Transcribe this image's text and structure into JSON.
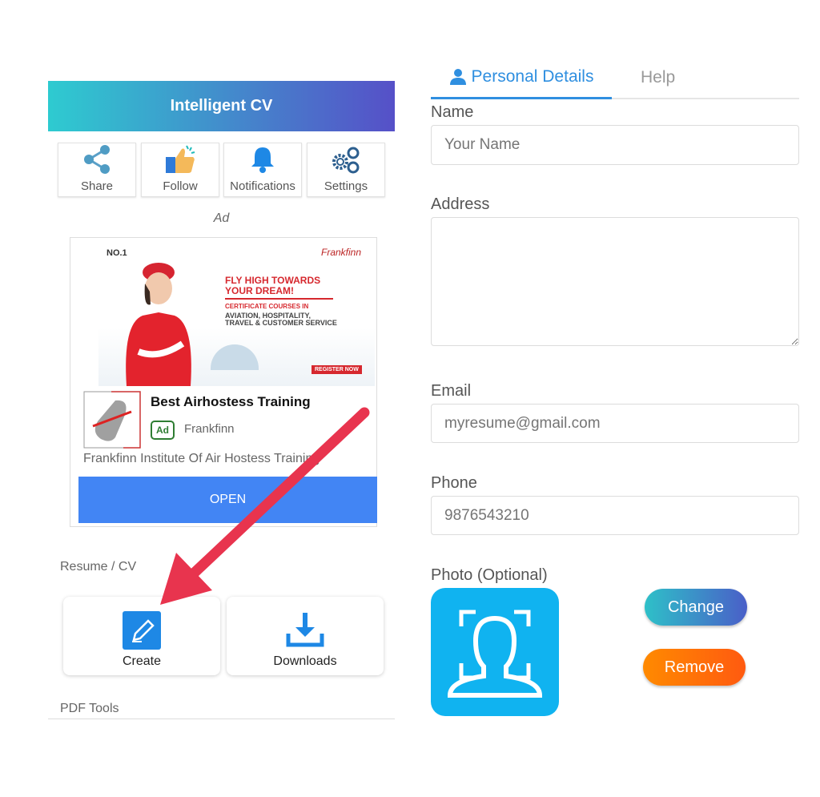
{
  "left": {
    "app_title": "Intelligent CV",
    "tiles": [
      {
        "label": "Share",
        "icon": "share-icon"
      },
      {
        "label": "Follow",
        "icon": "thumbs-up-icon"
      },
      {
        "label": "Notifications",
        "icon": "bell-icon"
      },
      {
        "label": "Settings",
        "icon": "gear-icon"
      }
    ],
    "ad_label": "Ad",
    "ad": {
      "banner": {
        "badge": "NO.1",
        "brand": "Frankfinn",
        "headline1": "FLY HIGH TOWARDS",
        "headline2": "YOUR DREAM!",
        "sub1": "CERTIFICATE COURSES IN",
        "sub2": "AVIATION, HOSPITALITY,",
        "sub3": "TRAVEL & CUSTOMER SERVICE",
        "cta": "REGISTER NOW"
      },
      "title": "Best Airhostess Training",
      "badge": "Ad",
      "advertiser": "Frankfinn",
      "description": "Frankfinn Institute Of Air Hostess Training",
      "open_label": "OPEN"
    },
    "resume_section": "Resume / CV",
    "cards": [
      {
        "label": "Create",
        "icon": "edit-icon"
      },
      {
        "label": "Downloads",
        "icon": "download-icon"
      }
    ],
    "pdf_section": "PDF Tools"
  },
  "right": {
    "tabs": [
      {
        "label": "Personal Details",
        "active": true
      },
      {
        "label": "Help",
        "active": false
      }
    ],
    "fields": {
      "name": {
        "label": "Name",
        "placeholder": "Your Name",
        "value": ""
      },
      "address": {
        "label": "Address",
        "placeholder": "",
        "value": ""
      },
      "email": {
        "label": "Email",
        "placeholder": "myresume@gmail.com",
        "value": ""
      },
      "phone": {
        "label": "Phone",
        "placeholder": "9876543210",
        "value": ""
      }
    },
    "photo_label": "Photo (Optional)",
    "change_label": "Change",
    "remove_label": "Remove"
  },
  "colors": {
    "accent": "#2f8fe0",
    "header_start": "#2ecbd0",
    "header_end": "#5650c8",
    "open": "#4285f4",
    "arrow": "#e8344e",
    "photo_bg": "#10b3f0",
    "remove": "#ff6a00"
  }
}
